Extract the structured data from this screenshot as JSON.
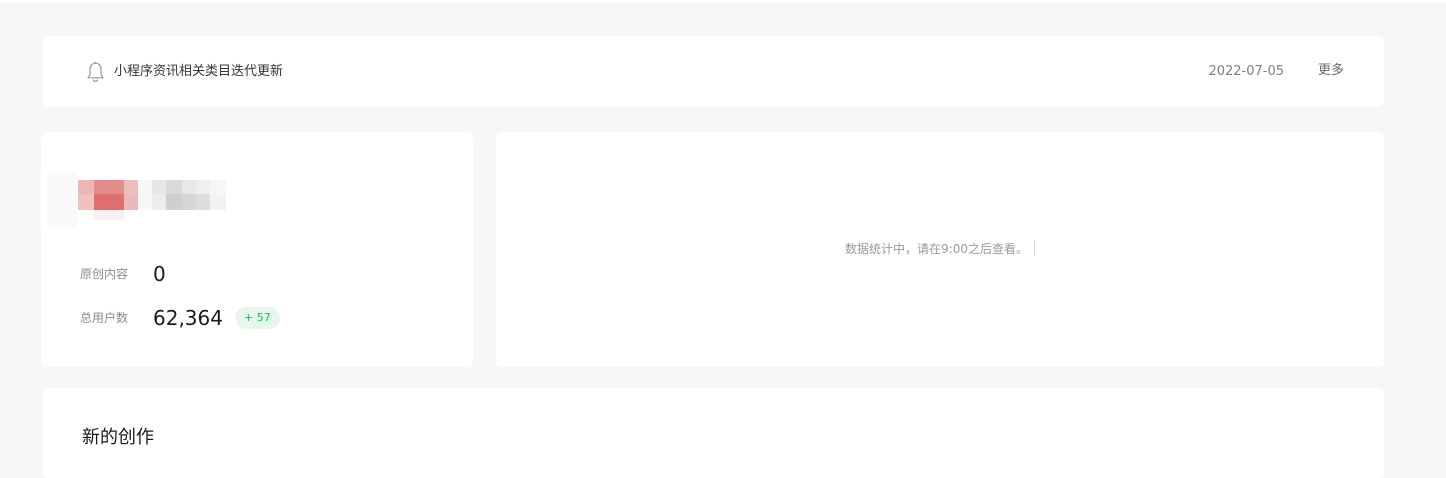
{
  "notice": {
    "icon": "bell-icon",
    "title": "小程序资讯相关类目迭代更新",
    "date": "2022-07-05",
    "more_label": "更多"
  },
  "account": {
    "logo": "account-logo-pixelated",
    "stats": [
      {
        "label": "原创内容",
        "value": "0"
      },
      {
        "label": "总用户数",
        "value": "62,364",
        "delta": "+ 57"
      }
    ]
  },
  "stats_panel": {
    "message": "数据统计中，请在9:00之后查看。"
  },
  "creation": {
    "heading": "新的创作"
  },
  "colors": {
    "page_bg": "#f6f7f9",
    "card_bg": "#ffffff",
    "accent_green": "#07c160",
    "delta_bg": "#e9f6ee"
  }
}
